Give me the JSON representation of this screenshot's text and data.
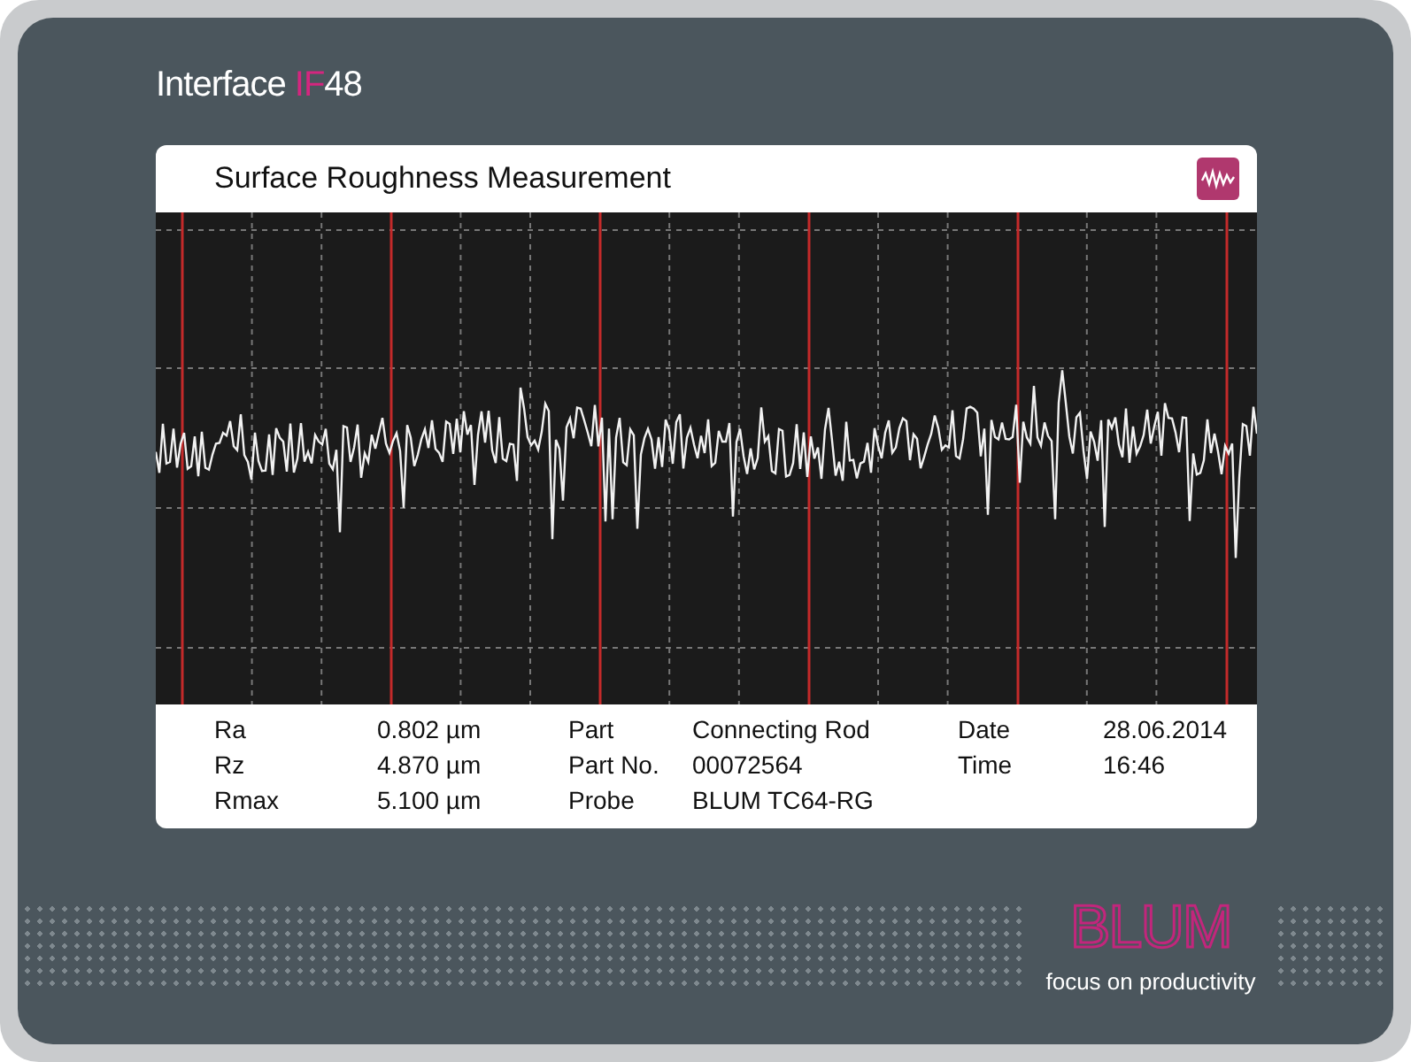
{
  "device_label": {
    "text": "Interface ",
    "accent": "IF",
    "suffix": "48"
  },
  "screen": {
    "title": "Surface Roughness Measurement",
    "results": [
      {
        "label": "Ra",
        "value": "0.802 µm"
      },
      {
        "label": "Rz",
        "value": "4.870 µm"
      },
      {
        "label": "Rmax",
        "value": "5.100 µm"
      }
    ],
    "part_info": [
      {
        "label": "Part",
        "value": "Connecting Rod"
      },
      {
        "label": "Part No.",
        "value": "00072564"
      },
      {
        "label": "Probe",
        "value": "BLUM TC64-RG"
      }
    ],
    "timestamp": [
      {
        "label": "Date",
        "value": "28.06.2014"
      },
      {
        "label": "Time",
        "value": "16:46"
      }
    ]
  },
  "brand": {
    "logo": "BLUM",
    "tagline": "focus on productivity"
  }
}
